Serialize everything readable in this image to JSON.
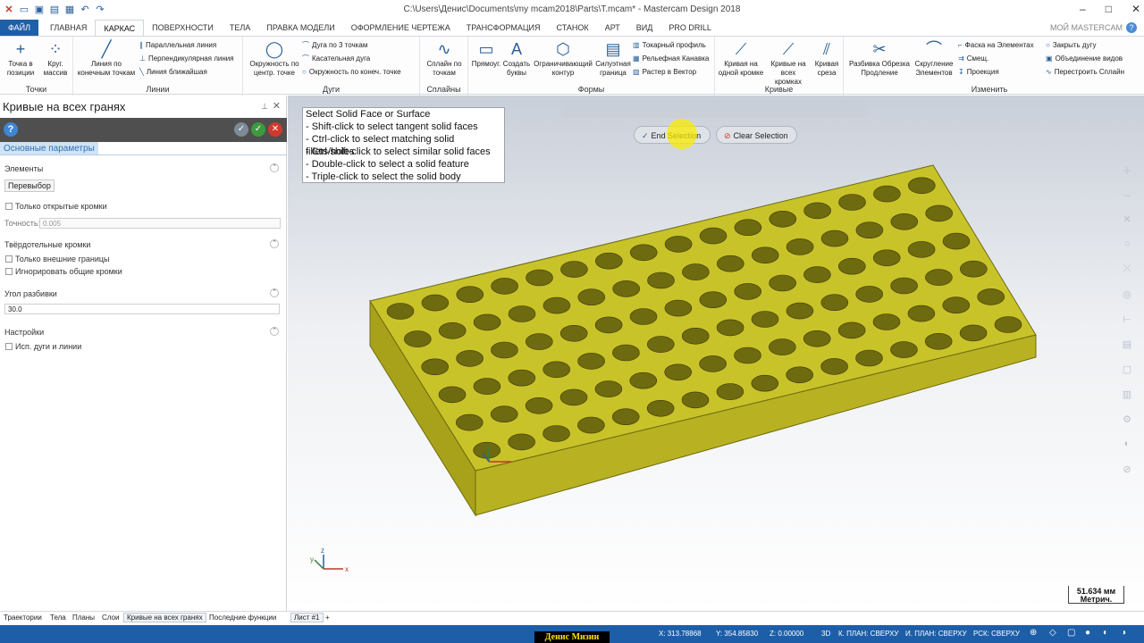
{
  "window": {
    "title": "C:\\Users\\Денис\\Documents\\my mcam2018\\Parts\\T.mcam* - Mastercam Design 2018"
  },
  "tabs": {
    "file": "ФАЙЛ",
    "home": "ГЛАВНАЯ",
    "wireframe": "КАРКАС",
    "surfaces": "ПОВЕРХНОСТИ",
    "solids": "ТЕЛА",
    "model_prep": "ПРАВКА МОДЕЛИ",
    "drafting": "ОФОРМЛЕНИЕ ЧЕРТЕЖА",
    "transform": "ТРАНСФОРМАЦИЯ",
    "machine": "СТАНОК",
    "art": "АРТ",
    "view": "ВИД",
    "prodrill": "PRO DRILL",
    "my_mastercam": "МОЙ MASTERCAM"
  },
  "ribbon": {
    "points": {
      "label": "Точки",
      "point_position": "Точка в позиции",
      "circle_array": "Круг. массив"
    },
    "lines": {
      "label": "Линии",
      "line_endpoints": "Линия по конечным точкам",
      "parallel": "Параллельная линия",
      "perpendicular": "Перпендикулярная линия",
      "closest": "Линия ближайшая"
    },
    "arcs": {
      "label": "Дуги",
      "circle_center": "Окружность по центр. точке",
      "arc_3pt": "Дуга по 3 точкам",
      "tangent_arc": "Касательная дуга",
      "circle_endpoints": "Окружность по конеч. точке"
    },
    "splines": {
      "label": "Сплайны",
      "spline_points": "Сплайн по точкам"
    },
    "shapes": {
      "label": "Формы",
      "rectangle": "Прямоуг.",
      "create_letters": "Создать буквы",
      "bounding_box": "Ограничивающий контур",
      "silhouette": "Силуэтная граница",
      "turn_profile": "Токарный профиль",
      "relief_groove": "Рельефная Канавка",
      "raster_vector": "Растер в Вектор"
    },
    "curves": {
      "label": "Кривые",
      "curve_one_edge": "Кривая на одной кромке",
      "curves_all_edges": "Кривые на всех кромках",
      "curve_slice": "Кривая среза"
    },
    "modify": {
      "label": "Изменить",
      "break_trim": "Разбивка Обрезка Продление",
      "fillet": "Скругление Элементов",
      "chamfer": "Фаска на Элементах",
      "offset": "Смещ.",
      "projection": "Проекция",
      "close_arc": "Закрыть дугу",
      "combine_views": "Объединение видов",
      "rebuild_spline": "Перестроить Сплайн"
    }
  },
  "panel": {
    "title": "Кривые на всех гранях",
    "tab": "Основные параметры",
    "elements_header": "Элементы",
    "reselect": "Перевыбор",
    "only_open_edges": "Только открытые кромки",
    "tolerance_label": "Точность:",
    "tolerance_value": "0.005",
    "solid_edges_header": "Твёрдотельные кромки",
    "only_outer": "Только внешние границы",
    "ignore_shared": "Игнорировать общие кромки",
    "break_angle_header": "Угол разбивки",
    "break_angle_value": "30.0",
    "settings_header": "Настройки",
    "use_arcs_lines": "Исп. дуги и линии"
  },
  "tooltip": {
    "lines": [
      "Select Solid Face or Surface",
      "- Shift-click to select tangent solid faces",
      "- Ctrl-click to select matching solid fillets/holes",
      "- Ctrl-shift-click to select similar solid faces",
      "- Double-click to select a solid feature",
      "- Triple-click to select the solid body"
    ]
  },
  "selection": {
    "end": "End Selection",
    "clear": "Clear Selection"
  },
  "model": {
    "rows": 6,
    "cols": 16,
    "top_color": "#c9c32a",
    "side_color": "#a8a21a",
    "hole_color": "#6e6a10"
  },
  "scale": {
    "value": "51.634 мм",
    "unit": "Метрич."
  },
  "bottom_tabs": {
    "toolpaths": "Траектории",
    "solids": "Тела",
    "planes": "Планы",
    "levels": "Слои",
    "curves_all_faces": "Кривые на всех гранях",
    "recent": "Последние функции",
    "sheet": "Лист #1"
  },
  "status": {
    "x": "X:  313.78868",
    "y": "Y:  354.85830",
    "z": "Z:  0.00000",
    "mode": "3D",
    "cplane": "К. ПЛАН: СВЕРХУ",
    "tplane": "И. ПЛАН: СВЕРХУ",
    "wcs": "РСК: СВЕРХУ"
  },
  "author": "Денис Мизин",
  "colors": {
    "accent": "#1f5fa8",
    "panel_header": "#4f4f4f",
    "status_bar": "#1d5ea9"
  }
}
